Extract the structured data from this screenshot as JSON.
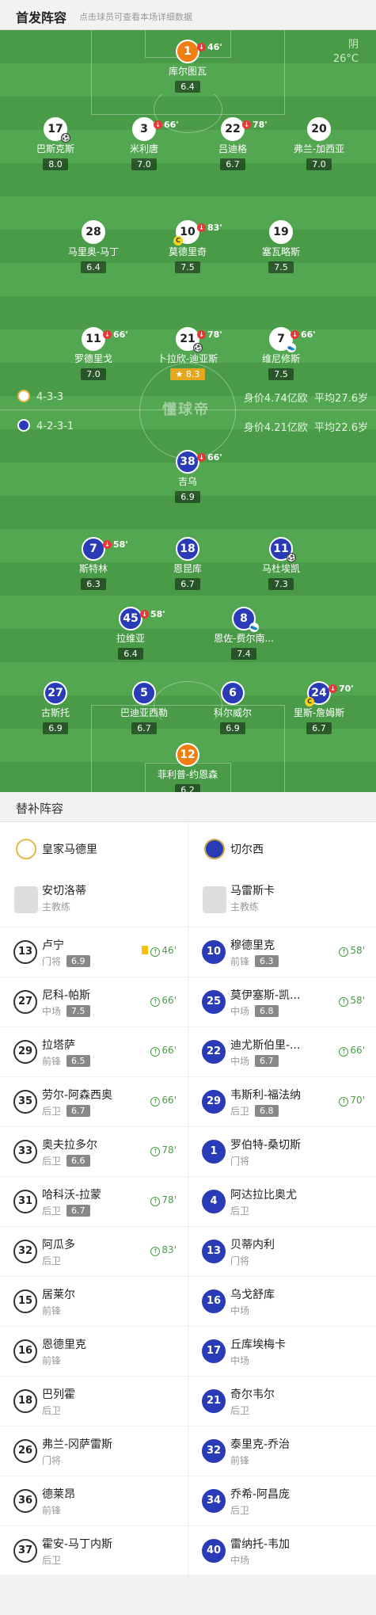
{
  "header": {
    "title": "首发阵容",
    "hint": "点击球员可查看本场详细数据"
  },
  "weather": {
    "condition": "阴",
    "temp": "26°C"
  },
  "watermark": "懂球帝",
  "home": {
    "formation": "4-3-3",
    "value": "身价4.74亿欧",
    "age": "平均27.6岁",
    "color": "#ffffff",
    "players": [
      {
        "num": "1",
        "name": "库尔图瓦",
        "rating": "6.4",
        "sub": "46'",
        "gk": true
      },
      {
        "num": "17",
        "name": "巴斯克斯",
        "rating": "8.0",
        "goal": true
      },
      {
        "num": "3",
        "name": "米利唐",
        "rating": "7.0",
        "sub": "66'"
      },
      {
        "num": "22",
        "name": "吕迪格",
        "rating": "6.7",
        "sub": "78'"
      },
      {
        "num": "20",
        "name": "弗兰-加西亚",
        "rating": "7.0"
      },
      {
        "num": "28",
        "name": "马里奥-马丁",
        "rating": "6.4"
      },
      {
        "num": "10",
        "name": "莫德里奇",
        "rating": "7.5",
        "sub": "83'",
        "captain": true
      },
      {
        "num": "19",
        "name": "塞瓦略斯",
        "rating": "7.5"
      },
      {
        "num": "11",
        "name": "罗德里戈",
        "rating": "7.0",
        "sub": "66'"
      },
      {
        "num": "21",
        "name": "卜拉欣-迪亚斯",
        "rating": "8.3",
        "sub": "78'",
        "goal": true,
        "assist": true,
        "best": true
      },
      {
        "num": "7",
        "name": "维尼修斯",
        "rating": "7.5",
        "sub": "66'",
        "assist": true
      }
    ]
  },
  "away": {
    "formation": "4-2-3-1",
    "value": "身价4.21亿欧",
    "age": "平均22.6岁",
    "color": "#2a3bb7",
    "players": [
      {
        "num": "38",
        "name": "吉乌",
        "rating": "6.9",
        "sub": "66'"
      },
      {
        "num": "7",
        "name": "斯特林",
        "rating": "6.3",
        "sub": "58'"
      },
      {
        "num": "18",
        "name": "恩昆库",
        "rating": "6.7"
      },
      {
        "num": "11",
        "name": "马杜埃凯",
        "rating": "7.3",
        "goal": true
      },
      {
        "num": "45",
        "name": "拉维亚",
        "rating": "6.4",
        "sub": "58'"
      },
      {
        "num": "8",
        "name": "恩佐-费尔南...",
        "rating": "7.4",
        "assist": true
      },
      {
        "num": "27",
        "name": "古斯托",
        "rating": "6.9"
      },
      {
        "num": "5",
        "name": "巴迪亚西勒",
        "rating": "6.7"
      },
      {
        "num": "6",
        "name": "科尔威尔",
        "rating": "6.9"
      },
      {
        "num": "24",
        "name": "里斯-詹姆斯",
        "rating": "6.7",
        "sub": "70'",
        "captain": true
      },
      {
        "num": "12",
        "name": "菲利普-约恩森",
        "rating": "6.2",
        "gk": true
      }
    ]
  },
  "subs": {
    "title": "替补阵容",
    "home_team": "皇家马德里",
    "away_team": "切尔西",
    "home_coach": {
      "name": "安切洛蒂",
      "role": "主教练"
    },
    "away_coach": {
      "name": "马雷斯卡",
      "role": "主教练"
    },
    "home": [
      {
        "num": "13",
        "name": "卢宁",
        "pos": "门将",
        "rating": "6.9",
        "in": "46'",
        "yellow": true
      },
      {
        "num": "27",
        "name": "尼科-帕斯",
        "pos": "中场",
        "rating": "7.5",
        "in": "66'"
      },
      {
        "num": "29",
        "name": "拉塔萨",
        "pos": "前锋",
        "rating": "6.5",
        "in": "66'"
      },
      {
        "num": "35",
        "name": "劳尔-阿森西奥",
        "pos": "后卫",
        "rating": "6.7",
        "in": "66'"
      },
      {
        "num": "33",
        "name": "奥夫拉多尔",
        "pos": "后卫",
        "rating": "6.6",
        "in": "78'"
      },
      {
        "num": "31",
        "name": "哈科沃-拉蒙",
        "pos": "后卫",
        "rating": "6.7",
        "in": "78'"
      },
      {
        "num": "32",
        "name": "阿瓜多",
        "pos": "后卫",
        "in": "83'"
      },
      {
        "num": "15",
        "name": "居莱尔",
        "pos": "前锋"
      },
      {
        "num": "16",
        "name": "恩德里克",
        "pos": "前锋"
      },
      {
        "num": "18",
        "name": "巴列霍",
        "pos": "后卫"
      },
      {
        "num": "26",
        "name": "弗兰-冈萨雷斯",
        "pos": "门将"
      },
      {
        "num": "36",
        "name": "德莱昂",
        "pos": "前锋"
      },
      {
        "num": "37",
        "name": "霍安-马丁内斯",
        "pos": "后卫"
      }
    ],
    "away": [
      {
        "num": "10",
        "name": "穆德里克",
        "pos": "前锋",
        "rating": "6.3",
        "in": "58'"
      },
      {
        "num": "25",
        "name": "莫伊塞斯-凯...",
        "pos": "中场",
        "rating": "6.8",
        "in": "58'"
      },
      {
        "num": "22",
        "name": "迪尤斯伯里-...",
        "pos": "中场",
        "rating": "6.7",
        "in": "66'"
      },
      {
        "num": "29",
        "name": "韦斯利-福法纳",
        "pos": "后卫",
        "rating": "6.8",
        "in": "70'"
      },
      {
        "num": "1",
        "name": "罗伯特-桑切斯",
        "pos": "门将"
      },
      {
        "num": "4",
        "name": "阿达拉比奥尤",
        "pos": "后卫"
      },
      {
        "num": "13",
        "name": "贝蒂内利",
        "pos": "门将"
      },
      {
        "num": "16",
        "name": "乌戈舒库",
        "pos": "中场"
      },
      {
        "num": "17",
        "name": "丘库埃梅卡",
        "pos": "中场"
      },
      {
        "num": "21",
        "name": "奇尔韦尔",
        "pos": "后卫"
      },
      {
        "num": "32",
        "name": "泰里克-乔治",
        "pos": "前锋"
      },
      {
        "num": "34",
        "name": "乔希-阿昌庞",
        "pos": "后卫"
      },
      {
        "num": "40",
        "name": "雷纳托-韦加",
        "pos": "中场"
      }
    ]
  }
}
